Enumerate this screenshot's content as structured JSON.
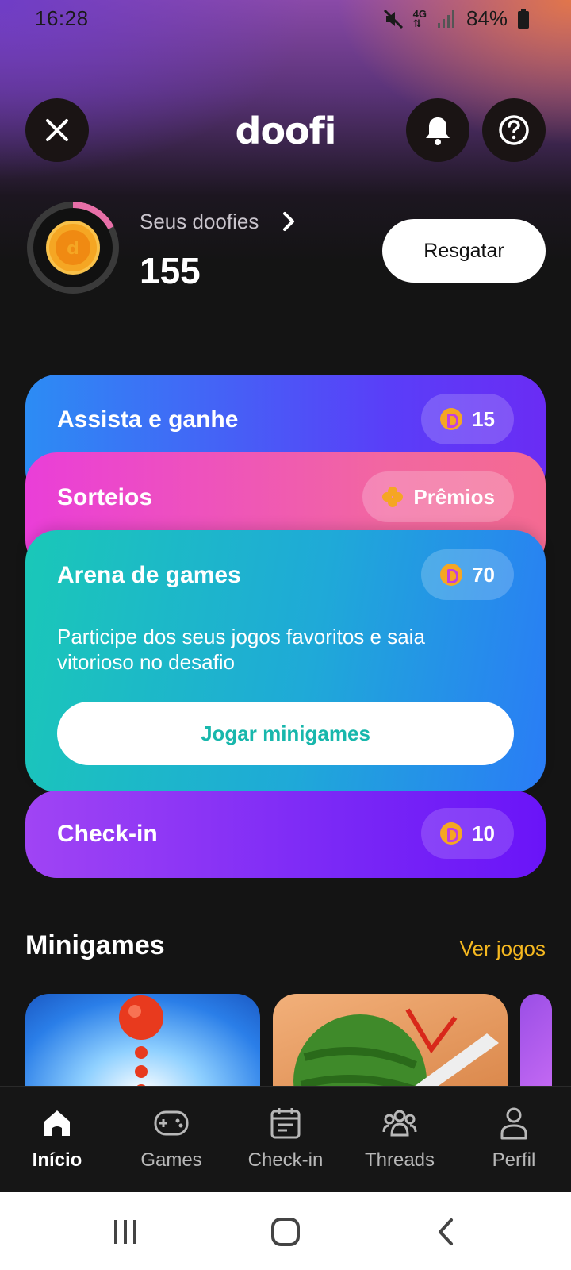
{
  "status_bar": {
    "time": "16:28",
    "network": "4G",
    "battery": "84%"
  },
  "header": {
    "logo": "doofi"
  },
  "balance": {
    "label": "Seus doofies",
    "count": "155",
    "redeem_label": "Resgatar"
  },
  "cards": {
    "watch": {
      "title": "Assista e ganhe",
      "reward": "15"
    },
    "raffle": {
      "title": "Sorteios",
      "badge": "Prêmios"
    },
    "arena": {
      "title": "Arena de games",
      "reward": "70",
      "description": "Participe dos seus jogos favoritos e saia vitorioso no desafio",
      "button": "Jogar minigames"
    },
    "checkin": {
      "title": "Check-in",
      "reward": "10"
    }
  },
  "minigames": {
    "title": "Minigames",
    "link": "Ver jogos"
  },
  "bottom_nav": [
    {
      "label": "Início",
      "icon": "home-icon",
      "active": true
    },
    {
      "label": "Games",
      "icon": "gamepad-icon",
      "active": false
    },
    {
      "label": "Check-in",
      "icon": "calendar-icon",
      "active": false
    },
    {
      "label": "Threads",
      "icon": "users-icon",
      "active": false
    },
    {
      "label": "Perfil",
      "icon": "person-icon",
      "active": false
    }
  ],
  "colors": {
    "accent_link": "#f5b820",
    "coin": "#f5a623",
    "play_button_text": "#18b7ac"
  }
}
